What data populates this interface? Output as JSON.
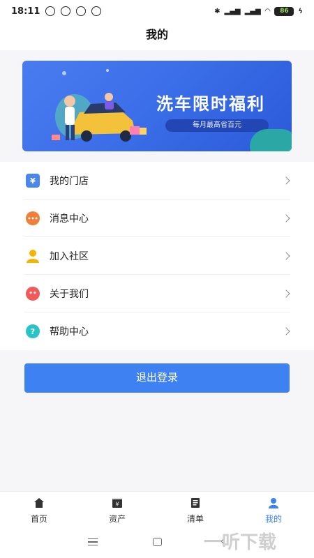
{
  "status_bar": {
    "time": "18:11",
    "battery": "86"
  },
  "header": {
    "title": "我的"
  },
  "banner": {
    "title": "洗车限时福利",
    "subtitle": "每月最高省百元"
  },
  "menu": {
    "items": [
      {
        "label": "我的门店",
        "icon": "store-icon",
        "icon_glyph": "¥",
        "color": "#4a86f0"
      },
      {
        "label": "消息中心",
        "icon": "message-icon",
        "icon_glyph": "•••",
        "color": "#f07f3a"
      },
      {
        "label": "加入社区",
        "icon": "community-icon",
        "icon_glyph": "",
        "color": "#f5b400"
      },
      {
        "label": "关于我们",
        "icon": "about-icon",
        "icon_glyph": "••",
        "color": "#f25a5a"
      },
      {
        "label": "帮助中心",
        "icon": "help-icon",
        "icon_glyph": "?",
        "color": "#29c4c7"
      }
    ]
  },
  "logout": {
    "label": "退出登录"
  },
  "tabs": [
    {
      "label": "首页",
      "icon": "home-icon"
    },
    {
      "label": "资产",
      "icon": "wallet-icon"
    },
    {
      "label": "清单",
      "icon": "list-icon"
    },
    {
      "label": "我的",
      "icon": "person-icon",
      "active": true
    }
  ],
  "colors": {
    "accent": "#3e81f2",
    "banner_blue": "#3a6de8"
  },
  "watermark": {
    "text": "一听下载"
  }
}
